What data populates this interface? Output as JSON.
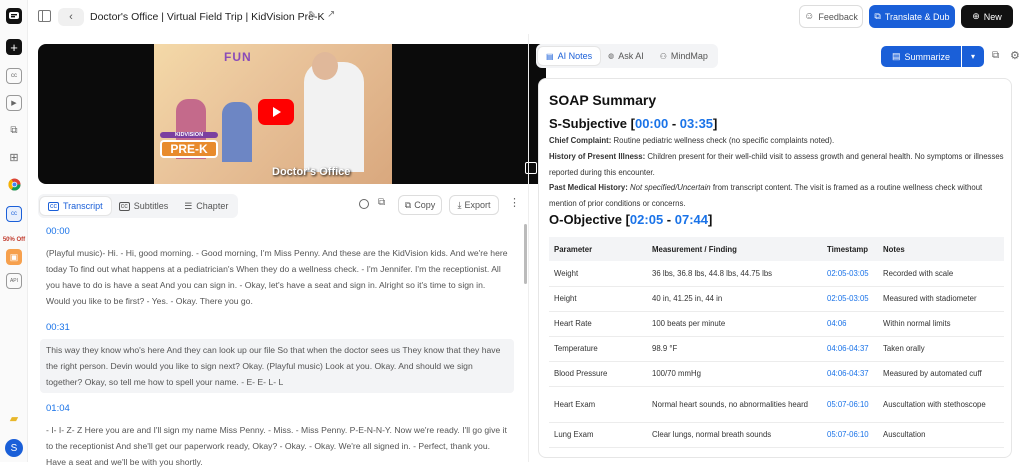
{
  "header": {
    "title": "Doctor's Office | Virtual Field Trip | KidVision Pre-K",
    "feedback": "Feedback",
    "translate": "Translate & Dub",
    "new": "New"
  },
  "sidebar": {
    "promo": "50% Off",
    "avatar": "S"
  },
  "video": {
    "brand": "KIDVISION",
    "logo": "PRE-K",
    "caption": "Doctor's Office",
    "wall": "FUN"
  },
  "transcript_tabs": [
    {
      "label": "Transcript"
    },
    {
      "label": "Subtitles"
    },
    {
      "label": "Chapter"
    }
  ],
  "transcript_actions": {
    "copy": "Copy",
    "export": "Export"
  },
  "transcript": [
    {
      "time": "00:00",
      "text": "(Playful music)- Hi. - Hi, good morning. - Good morning, I'm Miss Penny. And these are the KidVision kids. And we're here today To find out what happens at a pediatrician's When they do a wellness check. - I'm Jennifer. I'm the receptionist. All you have to do is have a seat And you can sign in. - Okay, let's have a seat and sign in. Alright so it's time to sign in. Would you like to be first? - Yes. - Okay. There you go."
    },
    {
      "time": "00:31",
      "text": "This way they know who's here And they can look up our file So that when the doctor sees us They know that they have the right person. Devin would you like to sign next? Okay. (Playful music) Look at you. Okay. And should we sign together? Okay, so tell me how to spell your name. - E- E- L- L"
    },
    {
      "time": "01:04",
      "text": "- I- I- Z- Z Here you are and I'll sign my name Miss Penny. - Miss. - Miss Penny. P-E-N-N-Y. Now we're ready. I'll go give it to the receptionist And she'll get our paperwork ready, Okay? - Okay. - Okay. We're all signed in. - Perfect, thank you. Have a seat and we'll be with you shortly."
    }
  ],
  "ai_tabs": [
    {
      "label": "AI Notes"
    },
    {
      "label": "Ask AI"
    },
    {
      "label": "MindMap"
    }
  ],
  "summarize": "Summarize",
  "soap": {
    "title": "SOAP Summary",
    "s_label": "S-Subjective [",
    "s_start": "00:00",
    "s_sep": " - ",
    "s_end": "03:35",
    "s_close": "]",
    "cc_label": "Chief Complaint:",
    "cc": " Routine pediatric wellness check (no specific complaints noted).",
    "hpi_label": "History of Present Illness:",
    "hpi": " Children present for their well-child visit to assess growth and general health. No symptoms or illnesses reported during this encounter.",
    "pmh_label": "Past Medical History:",
    "pmh_em": " Not specified/Uncertain",
    "pmh": " from transcript content. The visit is framed as a routine wellness check without mention of prior conditions or concerns.",
    "o_label": "O-Objective [",
    "o_start": "02:05",
    "o_sep": " - ",
    "o_end": "07:44",
    "o_close": "]",
    "headers": [
      "Parameter",
      "Measurement / Finding",
      "Timestamp",
      "Notes"
    ],
    "rows": [
      [
        "Weight",
        "36 lbs, 36.8 lbs, 44.8 lbs, 44.75 lbs",
        "02:05-03:05",
        "Recorded with scale"
      ],
      [
        "Height",
        "40 in, 41.25 in, 44 in",
        "02:05-03:05",
        "Measured with stadiometer"
      ],
      [
        "Heart Rate",
        "100 beats per minute",
        "04:06",
        "Within normal limits"
      ],
      [
        "Temperature",
        "98.9 °F",
        "04:06-04:37",
        "Taken orally"
      ],
      [
        "Blood Pressure",
        "100/70 mmHg",
        "04:06-04:37",
        "Measured by automated cuff"
      ],
      [
        "Heart Exam",
        "Normal heart sounds, no abnormalities heard",
        "05:07-06:10",
        "Auscultation with stethoscope"
      ],
      [
        "Lung Exam",
        "Clear lungs, normal breath sounds",
        "05:07-06:10",
        "Auscultation"
      ]
    ]
  },
  "colors": {
    "primary": "#1a5fd8",
    "link": "#1a73e8",
    "dark": "#111111"
  }
}
